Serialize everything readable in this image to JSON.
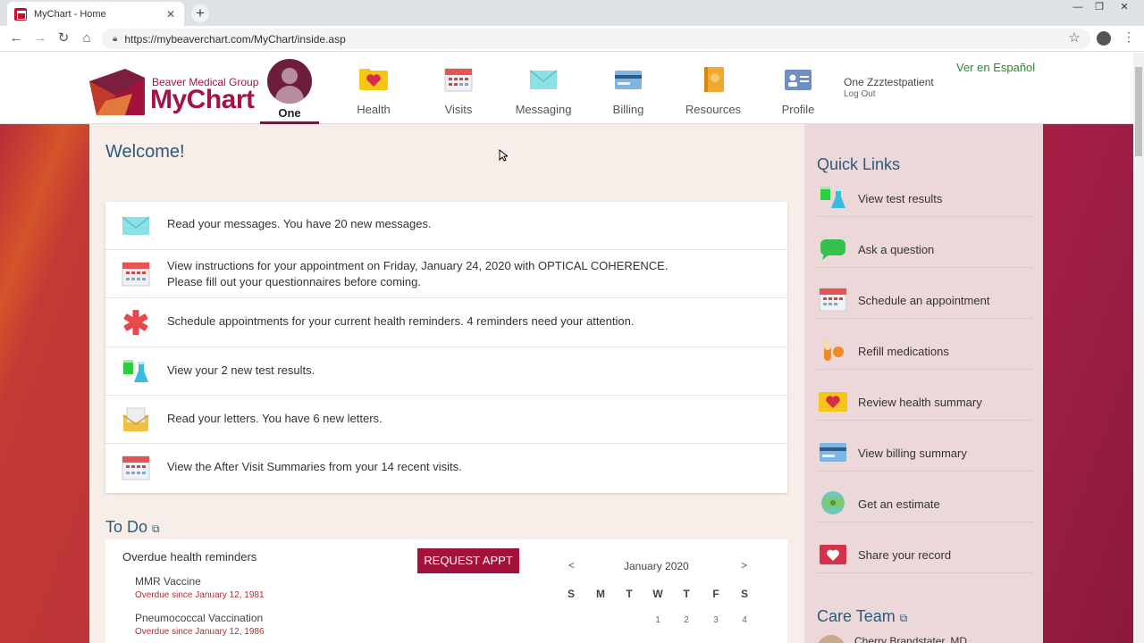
{
  "browser": {
    "tab_title": "MyChart - Home",
    "new_tab": "+",
    "url": "https://mybeaverchart.com/MyChart/inside.asp"
  },
  "header": {
    "logo_sub": "Beaver Medical Group",
    "logo_main": "MyChart",
    "nav": [
      {
        "label": "One",
        "icon": "avatar-icon"
      },
      {
        "label": "Health",
        "icon": "heart-folder-icon"
      },
      {
        "label": "Visits",
        "icon": "calendar-icon"
      },
      {
        "label": "Messaging",
        "icon": "envelope-icon"
      },
      {
        "label": "Billing",
        "icon": "credit-card-icon"
      },
      {
        "label": "Resources",
        "icon": "book-icon"
      },
      {
        "label": "Profile",
        "icon": "id-card-icon"
      }
    ],
    "username": "One Zzztestpatient",
    "logout": "Log Out",
    "language_link": "Ver en Español"
  },
  "main": {
    "welcome": "Welcome!",
    "messages": [
      {
        "icon": "envelope-icon",
        "line1": "Read your messages. You have 20 new messages.",
        "line2": ""
      },
      {
        "icon": "calendar-icon",
        "line1": "View instructions for your appointment on Friday, January 24, 2020 with OPTICAL COHERENCE.",
        "line2": "Please fill out your questionnaires before coming."
      },
      {
        "icon": "medical-star-icon",
        "line1": "Schedule appointments for your current health reminders. 4 reminders need your attention.",
        "line2": ""
      },
      {
        "icon": "test-tubes-icon",
        "line1": "View your 2 new test results.",
        "line2": ""
      },
      {
        "icon": "letter-icon",
        "line1": "Read your letters. You have 6 new letters.",
        "line2": ""
      },
      {
        "icon": "calendar-icon",
        "line1": "View the After Visit Summaries from your 14 recent visits.",
        "line2": ""
      }
    ],
    "todo": {
      "title": "To Do",
      "heading": "Overdue health reminders",
      "request_button": "REQUEST APPT",
      "items": [
        {
          "name": "MMR Vaccine",
          "status": "Overdue since January 12, 1981"
        },
        {
          "name": "Pneumococcal Vaccination",
          "status": "Overdue since January 12, 1986"
        }
      ],
      "calendar": {
        "prev": "<",
        "next": ">",
        "month": "January 2020",
        "dow": [
          "S",
          "M",
          "T",
          "W",
          "T",
          "F",
          "S"
        ],
        "first_row_days": [
          "1",
          "2",
          "3",
          "4"
        ]
      }
    }
  },
  "sidebar": {
    "quick_links_title": "Quick Links",
    "quick_links": [
      {
        "label": "View test results",
        "icon": "test-tubes-icon"
      },
      {
        "label": "Ask a question",
        "icon": "chat-bubble-icon"
      },
      {
        "label": "Schedule an appointment",
        "icon": "calendar-icon"
      },
      {
        "label": "Refill medications",
        "icon": "pill-icon"
      },
      {
        "label": "Review health summary",
        "icon": "heart-folder-icon"
      },
      {
        "label": "View billing summary",
        "icon": "credit-card-icon"
      },
      {
        "label": "Get an estimate",
        "icon": "money-icon"
      },
      {
        "label": "Share your record",
        "icon": "share-record-icon"
      }
    ],
    "care_team_title": "Care Team",
    "care_team_first": "Cherry Brandstater, MD"
  }
}
